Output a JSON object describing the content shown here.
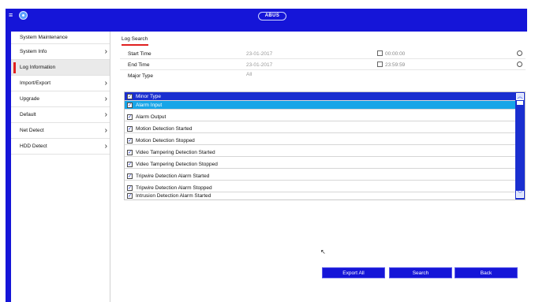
{
  "topbar": {
    "menu_icon": "menu-icon",
    "home_icon": "home-icon",
    "brand": "ABUS"
  },
  "sidebar": {
    "title": "System Maintenance",
    "items": [
      {
        "label": "System Info",
        "has_chevron": true,
        "active": false
      },
      {
        "label": "Log Information",
        "has_chevron": false,
        "active": true
      },
      {
        "label": "Import/Export",
        "has_chevron": true,
        "active": false
      },
      {
        "label": "Upgrade",
        "has_chevron": true,
        "active": false
      },
      {
        "label": "Default",
        "has_chevron": true,
        "active": false
      },
      {
        "label": "Net Detect",
        "has_chevron": true,
        "active": false
      },
      {
        "label": "HDD Detect",
        "has_chevron": true,
        "active": false
      }
    ]
  },
  "main": {
    "tab": "Log Search",
    "start_time": {
      "label": "Start Time",
      "date": "23-01-2017",
      "time": "00:00:00"
    },
    "end_time": {
      "label": "End Time",
      "date": "23-01-2017",
      "time": "23:59:59"
    },
    "major_type": {
      "label": "Major Type",
      "value": "All"
    },
    "minor_type": {
      "header": "Minor Type",
      "items": [
        {
          "label": "Alarm Input",
          "selected": true
        },
        {
          "label": "Alarm Output",
          "selected": false
        },
        {
          "label": "Motion Detection Started",
          "selected": false
        },
        {
          "label": "Motion Detection Stopped",
          "selected": false
        },
        {
          "label": "Video Tampering Detection Started",
          "selected": false
        },
        {
          "label": "Video Tampering Detection Stopped",
          "selected": false
        },
        {
          "label": "Tripwire Detection Alarm Started",
          "selected": false
        },
        {
          "label": "Tripwire Detection Alarm Stopped",
          "selected": false
        },
        {
          "label": "Intrusion Detection Alarm Started",
          "selected": false
        }
      ]
    }
  },
  "buttons": {
    "export_all": "Export All",
    "search": "Search",
    "back": "Back"
  },
  "colors": {
    "brand_blue": "#1515d8",
    "header_blue": "#1a2fd0",
    "selection_blue": "#17a5e8",
    "active_red": "#e02020"
  }
}
